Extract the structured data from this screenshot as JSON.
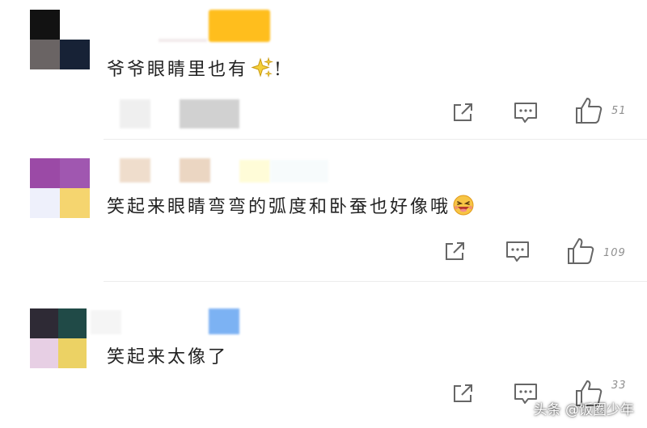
{
  "comments": [
    {
      "text": "爷爷眼睛里也有",
      "trailing": "!",
      "likes": "51",
      "avatar_colors": [
        "#121212",
        "#ffffff",
        "#6a6464",
        "#172236"
      ]
    },
    {
      "text": "笑起来眼睛弯弯的弧度和卧蚕也好像哦",
      "likes": "109",
      "avatar_colors": [
        "#9b4aa6",
        "#a057b0",
        "#eef0fb",
        "#f5d56f"
      ]
    },
    {
      "text": "笑起来太像了",
      "likes": "33",
      "avatar_colors": [
        "#2e2a35",
        "#204a47",
        "#e7cfe4",
        "#ecd264"
      ]
    }
  ],
  "icons": {
    "share": "share-icon",
    "comment": "comment-icon",
    "like": "thumbs-up-icon",
    "sparkle": "sparkles-emoji-icon",
    "laugh": "laughing-emoji-icon"
  },
  "watermark": "头条 @饭圈少年",
  "colors": {
    "text": "#222222",
    "icon": "#666666",
    "count": "#8f8f8f",
    "divider": "#ececec",
    "sparkle": "#f2c52e",
    "name_highlight": "#ffc21a"
  }
}
